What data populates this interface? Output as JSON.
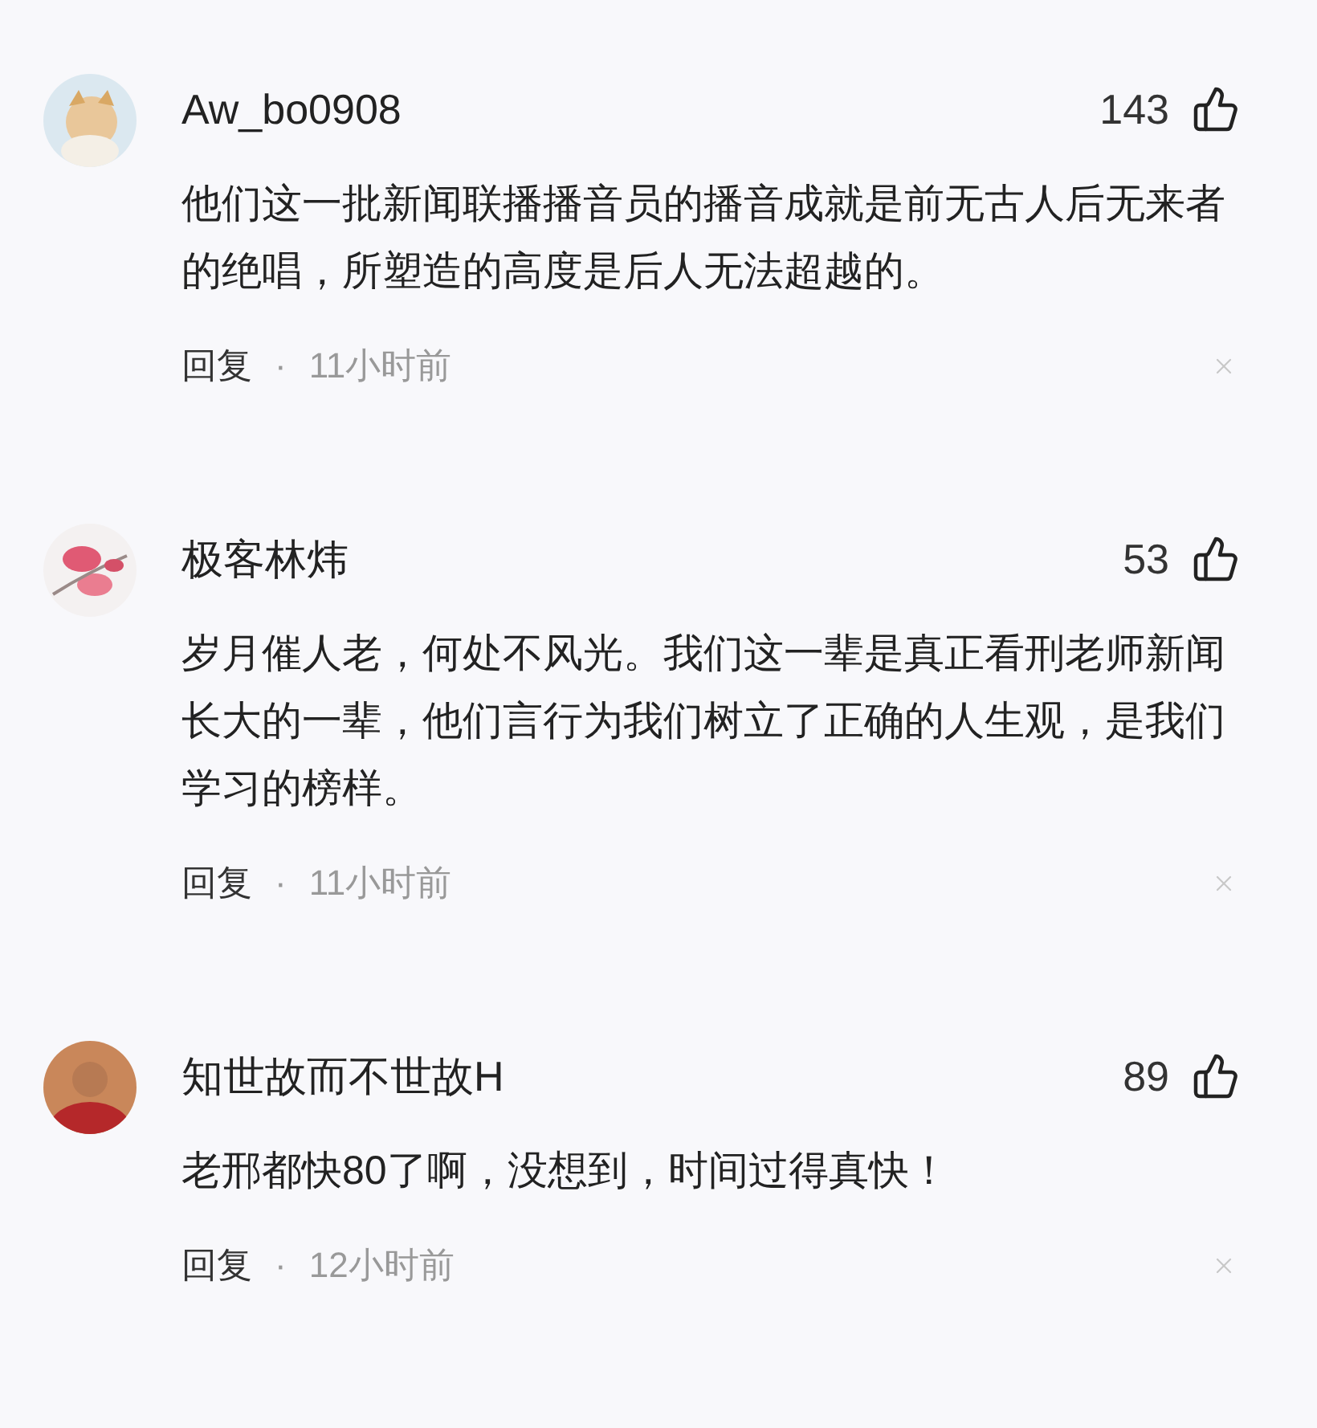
{
  "comments": [
    {
      "name": "Aw_bo0908",
      "likes": "143",
      "body": "他们这一批新闻联播播音员的播音成就是前无古人后无来者的绝唱，所塑造的高度是后人无法超越的。",
      "reply": "回复",
      "separator": "·",
      "time": "11小时前"
    },
    {
      "name": "极客林炜",
      "likes": "53",
      "body": "岁月催人老，何处不风光。我们这一辈是真正看刑老师新闻长大的一辈，他们言行为我们树立了正确的人生观，是我们学习的榜样。",
      "reply": "回复",
      "separator": "·",
      "time": "11小时前"
    },
    {
      "name": "知世故而不世故H",
      "likes": "89",
      "body": "老邢都快80了啊，没想到，时间过得真快！",
      "reply": "回复",
      "separator": "·",
      "time": "12小时前"
    }
  ]
}
